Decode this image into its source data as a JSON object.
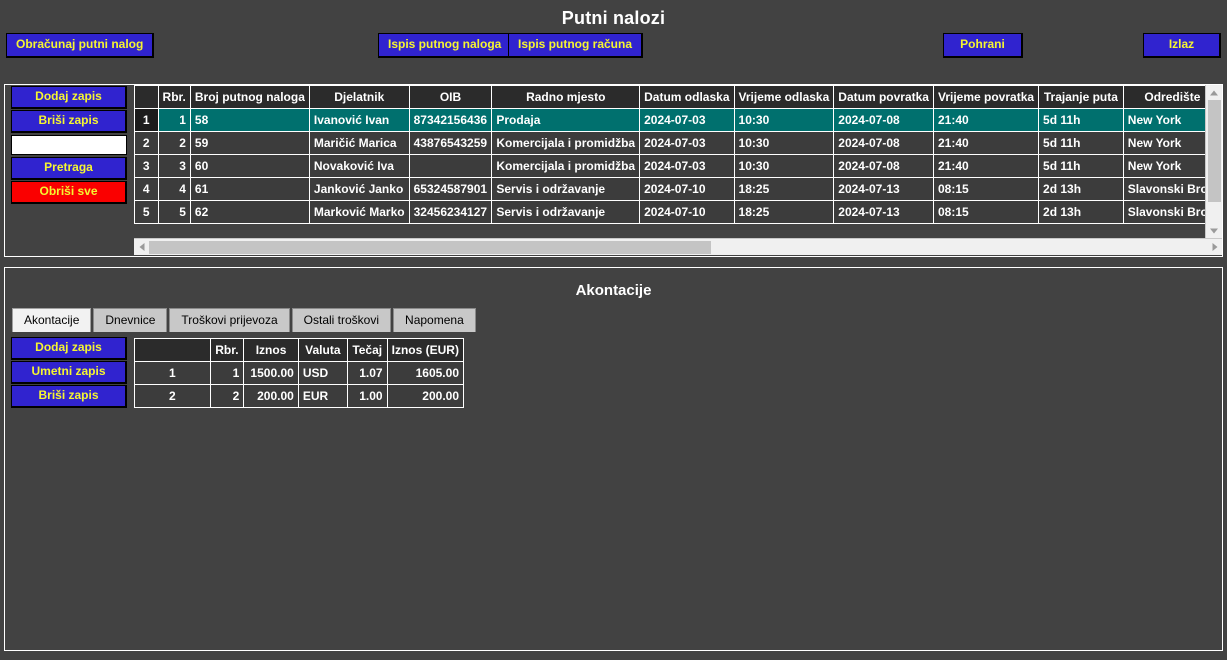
{
  "header": {
    "title": "Putni nalozi"
  },
  "toolbar": {
    "calc_label": "Obračunaj putni nalog",
    "print_order_label": "Ispis putnog naloga",
    "print_invoice_label": "Ispis putnog računa",
    "save_label": "Pohrani",
    "exit_label": "Izlaz"
  },
  "top_panel": {
    "side_buttons": {
      "add": "Dodaj zapis",
      "delete": "Briši zapis",
      "search": "Pretraga",
      "delete_all": "Obriši sve"
    },
    "search_input": {
      "value": "",
      "placeholder": ""
    },
    "columns": [
      "",
      "Rbr.",
      "Broj putnog naloga",
      "Djelatnik",
      "OIB",
      "Radno mjesto",
      "Datum odlaska",
      "Vrijeme odlaska",
      "Datum povratka",
      "Vrijeme povratka",
      "Trajanje puta",
      "Odredište"
    ],
    "rows": [
      {
        "selected": true,
        "hdr": "1",
        "rbr": "1",
        "broj": "58",
        "djelatnik": "Ivanović Ivan",
        "oib": "87342156436",
        "radno_mjesto": "Prodaja",
        "datum_odlaska": "2024-07-03",
        "vrijeme_odlaska": "10:30",
        "datum_povratka": "2024-07-08",
        "vrijeme_povratka": "21:40",
        "trajanje": "5d 11h",
        "odrediste": "New York"
      },
      {
        "selected": false,
        "hdr": "2",
        "rbr": "2",
        "broj": "59",
        "djelatnik": "Maričić Marica",
        "oib": "43876543259",
        "radno_mjesto": "Komercijala i promidžba",
        "datum_odlaska": "2024-07-03",
        "vrijeme_odlaska": "10:30",
        "datum_povratka": "2024-07-08",
        "vrijeme_povratka": "21:40",
        "trajanje": "5d 11h",
        "odrediste": "New York"
      },
      {
        "selected": false,
        "hdr": "3",
        "rbr": "3",
        "broj": "60",
        "djelatnik": "Novaković Iva",
        "oib": "",
        "radno_mjesto": "Komercijala i promidžba",
        "datum_odlaska": "2024-07-03",
        "vrijeme_odlaska": "10:30",
        "datum_povratka": "2024-07-08",
        "vrijeme_povratka": "21:40",
        "trajanje": "5d 11h",
        "odrediste": "New York"
      },
      {
        "selected": false,
        "hdr": "4",
        "rbr": "4",
        "broj": "61",
        "djelatnik": "Janković Janko",
        "oib": "65324587901",
        "radno_mjesto": "Servis i održavanje",
        "datum_odlaska": "2024-07-10",
        "vrijeme_odlaska": "18:25",
        "datum_povratka": "2024-07-13",
        "vrijeme_povratka": "08:15",
        "trajanje": "2d 13h",
        "odrediste": "Slavonski Brod"
      },
      {
        "selected": false,
        "hdr": "5",
        "rbr": "5",
        "broj": "62",
        "djelatnik": "Marković Marko",
        "oib": "32456234127",
        "radno_mjesto": "Servis i održavanje",
        "datum_odlaska": "2024-07-10",
        "vrijeme_odlaska": "18:25",
        "datum_povratka": "2024-07-13",
        "vrijeme_povratka": "08:15",
        "trajanje": "2d 13h",
        "odrediste": "Slavonski Brod"
      }
    ],
    "scroll": {
      "h_arrow_left": "◀",
      "h_arrow_right": "▶",
      "v_arrow_up": "▲",
      "v_arrow_down": "▼"
    }
  },
  "bottom_panel": {
    "title": "Akontacije",
    "tabs": [
      {
        "label": "Akontacije",
        "active": true
      },
      {
        "label": "Dnevnice",
        "active": false
      },
      {
        "label": "Troškovi prijevoza",
        "active": false
      },
      {
        "label": "Ostali troškovi",
        "active": false
      },
      {
        "label": "Napomena",
        "active": false
      }
    ],
    "side_buttons": {
      "add": "Dodaj zapis",
      "insert": "Umetni zapis",
      "delete": "Briši zapis"
    },
    "columns": [
      "",
      "Rbr.",
      "Iznos",
      "Valuta",
      "Tečaj",
      "Iznos (EUR)"
    ],
    "rows": [
      {
        "hdr": "1",
        "rbr": "1",
        "iznos": "1500.00",
        "valuta": "USD",
        "tecaj": "1.07",
        "iznos_eur": "1605.00"
      },
      {
        "hdr": "2",
        "rbr": "2",
        "iznos": "200.00",
        "valuta": "EUR",
        "tecaj": "1.00",
        "iznos_eur": "200.00"
      }
    ]
  },
  "colors": {
    "background": "#424242",
    "button": "#3023cf",
    "button_text": "#f5f531",
    "danger": "#fa0000",
    "selected_row": "#00706e",
    "grid_cell": "#3c3c3c",
    "grid_header": "#2b2b2b",
    "border": "#ffffff"
  }
}
